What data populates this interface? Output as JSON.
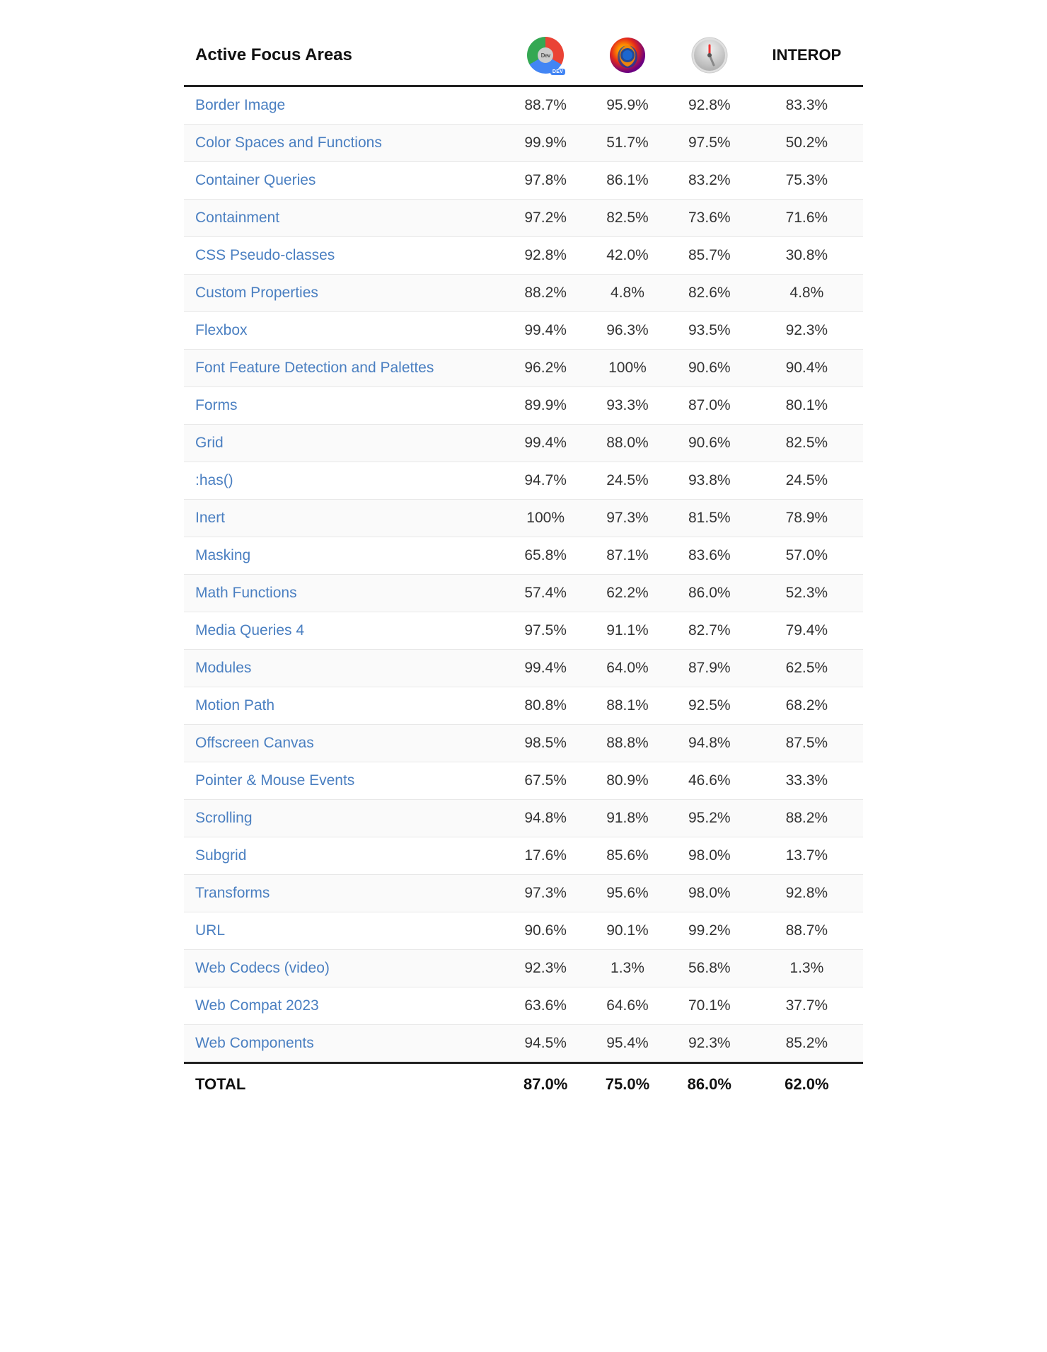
{
  "header": {
    "area_col_label": "Active Focus Areas",
    "col_interop": "INTEROP"
  },
  "rows": [
    {
      "name": "Border Image",
      "c1": "88.7%",
      "c2": "95.9%",
      "c3": "92.8%",
      "c4": "83.3%"
    },
    {
      "name": "Color Spaces and Functions",
      "c1": "99.9%",
      "c2": "51.7%",
      "c3": "97.5%",
      "c4": "50.2%"
    },
    {
      "name": "Container Queries",
      "c1": "97.8%",
      "c2": "86.1%",
      "c3": "83.2%",
      "c4": "75.3%"
    },
    {
      "name": "Containment",
      "c1": "97.2%",
      "c2": "82.5%",
      "c3": "73.6%",
      "c4": "71.6%"
    },
    {
      "name": "CSS Pseudo-classes",
      "c1": "92.8%",
      "c2": "42.0%",
      "c3": "85.7%",
      "c4": "30.8%"
    },
    {
      "name": "Custom Properties",
      "c1": "88.2%",
      "c2": "4.8%",
      "c3": "82.6%",
      "c4": "4.8%"
    },
    {
      "name": "Flexbox",
      "c1": "99.4%",
      "c2": "96.3%",
      "c3": "93.5%",
      "c4": "92.3%"
    },
    {
      "name": "Font Feature Detection and Palettes",
      "c1": "96.2%",
      "c2": "100%",
      "c3": "90.6%",
      "c4": "90.4%"
    },
    {
      "name": "Forms",
      "c1": "89.9%",
      "c2": "93.3%",
      "c3": "87.0%",
      "c4": "80.1%"
    },
    {
      "name": "Grid",
      "c1": "99.4%",
      "c2": "88.0%",
      "c3": "90.6%",
      "c4": "82.5%"
    },
    {
      "name": ":has()",
      "c1": "94.7%",
      "c2": "24.5%",
      "c3": "93.8%",
      "c4": "24.5%"
    },
    {
      "name": "Inert",
      "c1": "100%",
      "c2": "97.3%",
      "c3": "81.5%",
      "c4": "78.9%"
    },
    {
      "name": "Masking",
      "c1": "65.8%",
      "c2": "87.1%",
      "c3": "83.6%",
      "c4": "57.0%"
    },
    {
      "name": "Math Functions",
      "c1": "57.4%",
      "c2": "62.2%",
      "c3": "86.0%",
      "c4": "52.3%"
    },
    {
      "name": "Media Queries 4",
      "c1": "97.5%",
      "c2": "91.1%",
      "c3": "82.7%",
      "c4": "79.4%"
    },
    {
      "name": "Modules",
      "c1": "99.4%",
      "c2": "64.0%",
      "c3": "87.9%",
      "c4": "62.5%"
    },
    {
      "name": "Motion Path",
      "c1": "80.8%",
      "c2": "88.1%",
      "c3": "92.5%",
      "c4": "68.2%"
    },
    {
      "name": "Offscreen Canvas",
      "c1": "98.5%",
      "c2": "88.8%",
      "c3": "94.8%",
      "c4": "87.5%"
    },
    {
      "name": "Pointer & Mouse Events",
      "c1": "67.5%",
      "c2": "80.9%",
      "c3": "46.6%",
      "c4": "33.3%"
    },
    {
      "name": "Scrolling",
      "c1": "94.8%",
      "c2": "91.8%",
      "c3": "95.2%",
      "c4": "88.2%"
    },
    {
      "name": "Subgrid",
      "c1": "17.6%",
      "c2": "85.6%",
      "c3": "98.0%",
      "c4": "13.7%"
    },
    {
      "name": "Transforms",
      "c1": "97.3%",
      "c2": "95.6%",
      "c3": "98.0%",
      "c4": "92.8%"
    },
    {
      "name": "URL",
      "c1": "90.6%",
      "c2": "90.1%",
      "c3": "99.2%",
      "c4": "88.7%"
    },
    {
      "name": "Web Codecs (video)",
      "c1": "92.3%",
      "c2": "1.3%",
      "c3": "56.8%",
      "c4": "1.3%"
    },
    {
      "name": "Web Compat 2023",
      "c1": "63.6%",
      "c2": "64.6%",
      "c3": "70.1%",
      "c4": "37.7%"
    },
    {
      "name": "Web Components",
      "c1": "94.5%",
      "c2": "95.4%",
      "c3": "92.3%",
      "c4": "85.2%"
    }
  ],
  "footer": {
    "label": "TOTAL",
    "c1": "87.0%",
    "c2": "75.0%",
    "c3": "86.0%",
    "c4": "62.0%"
  }
}
